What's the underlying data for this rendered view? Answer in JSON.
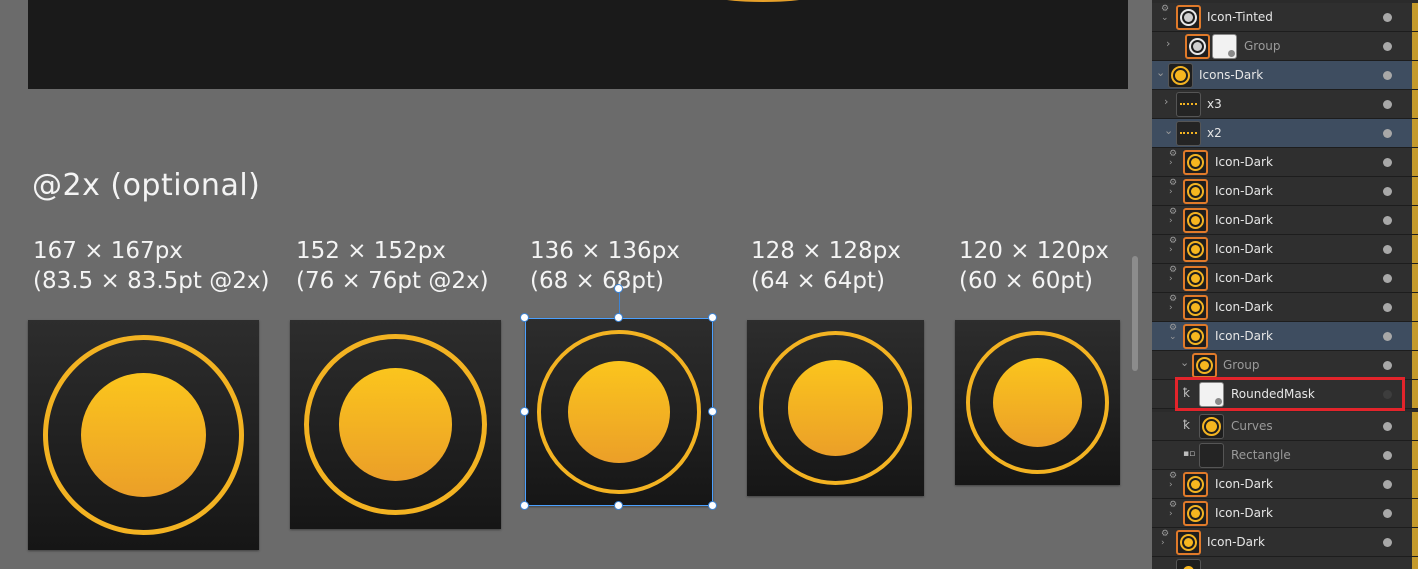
{
  "colors": {
    "canvas_bg": "#6b6b6b",
    "tile_dark": "#1f1f1f",
    "icon_yellow": "#f6b61f",
    "selection_blue": "#4aa0ff",
    "highlight_red": "#e3242b",
    "panel_bg": "#2b2b2b",
    "row_selected": "#3e4d60"
  },
  "canvas": {
    "section_title": "@2x (optional)",
    "sizes": [
      {
        "line1": "167 × 167px",
        "line2": "(83.5 × 83.5pt @2x)"
      },
      {
        "line1": "152 × 152px",
        "line2": "(76 × 76pt @2x)"
      },
      {
        "line1": "136 × 136px",
        "line2": "(68 × 68pt)"
      },
      {
        "line1": "128 × 128px",
        "line2": "(64 × 64pt)"
      },
      {
        "line1": "120 × 120px",
        "line2": "(60 × 60pt)"
      }
    ]
  },
  "layers": [
    {
      "name": "Icon-Tinted",
      "thumb": "tinted-icon",
      "visible": true
    },
    {
      "name": "Group",
      "thumb": "tinted-icon-and-mask",
      "visible": true,
      "dim": true
    },
    {
      "name": "Icons-Dark",
      "thumb": "icon",
      "visible": true,
      "selected": true
    },
    {
      "name": "x3",
      "thumb": "dotted-row",
      "visible": true
    },
    {
      "name": "x2",
      "thumb": "dotted-row",
      "visible": true,
      "selected": true
    },
    {
      "name": "Icon-Dark",
      "thumb": "icon",
      "visible": true
    },
    {
      "name": "Icon-Dark",
      "thumb": "icon",
      "visible": true
    },
    {
      "name": "Icon-Dark",
      "thumb": "icon",
      "visible": true
    },
    {
      "name": "Icon-Dark",
      "thumb": "icon",
      "visible": true
    },
    {
      "name": "Icon-Dark",
      "thumb": "icon",
      "visible": true
    },
    {
      "name": "Icon-Dark",
      "thumb": "icon",
      "visible": true
    },
    {
      "name": "Icon-Dark",
      "thumb": "icon",
      "visible": true,
      "selected": true
    },
    {
      "name": "Group",
      "thumb": "icon",
      "visible": true,
      "dim": true
    },
    {
      "name": "RoundedMask",
      "thumb": "white-mask",
      "visible": false,
      "highlighted": true
    },
    {
      "name": "Curves",
      "thumb": "icon",
      "visible": true,
      "dim": true
    },
    {
      "name": "Rectangle",
      "thumb": "dark-square",
      "visible": true,
      "dim": true
    },
    {
      "name": "Icon-Dark",
      "thumb": "icon",
      "visible": true
    },
    {
      "name": "Icon-Dark",
      "thumb": "icon",
      "visible": true
    },
    {
      "name": "Icon-Dark",
      "thumb": "icon",
      "visible": true
    }
  ]
}
